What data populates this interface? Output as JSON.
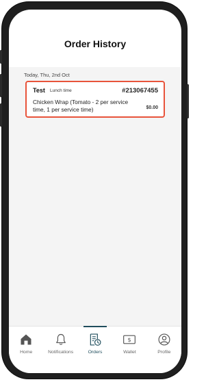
{
  "header": {
    "title": "Order History"
  },
  "orders": {
    "date_label": "Today, Thu, 2nd Oct",
    "items": [
      {
        "name": "Test",
        "tag": "Lunch time",
        "number": "#213067455",
        "description": "Chicken Wrap (Tomato - 2 per service time, 1 per service time)",
        "price": "$0.00"
      }
    ]
  },
  "nav": {
    "items": [
      {
        "label": "Home",
        "icon": "home-icon",
        "active": false
      },
      {
        "label": "Notifications",
        "icon": "bell-icon",
        "active": false
      },
      {
        "label": "Orders",
        "icon": "orders-icon",
        "active": true
      },
      {
        "label": "Wallet",
        "icon": "wallet-icon",
        "active": false
      },
      {
        "label": "Profile",
        "icon": "profile-icon",
        "active": false
      }
    ]
  },
  "colors": {
    "highlight_border": "#e8533a",
    "accent": "#1f4d5c",
    "frame": "#1f1f1f"
  }
}
